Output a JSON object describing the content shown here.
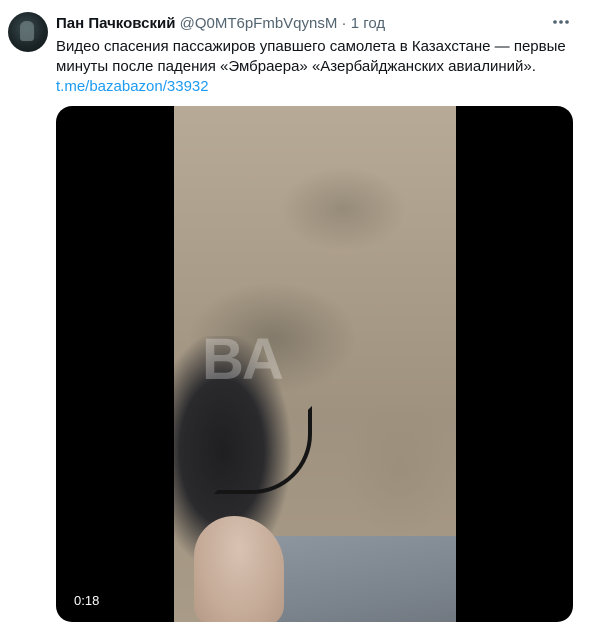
{
  "tweet": {
    "author_name": "Пан Пачковский",
    "author_handle": "@Q0MT6pFmbVqynsM",
    "separator": "·",
    "time": "1 год",
    "text": "Видео спасения пассажиров упавшего самолета в Казахстане — первые минуты после падения «Эмбраера» «Азербайджанских авиалиний».",
    "link": "t.me/bazabazon/33932",
    "more_icon": "more-options-icon"
  },
  "media": {
    "watermark": "BA",
    "duration": "0:18",
    "colors": {
      "link": "#1d9bf0",
      "secondary_text": "#536471"
    }
  }
}
